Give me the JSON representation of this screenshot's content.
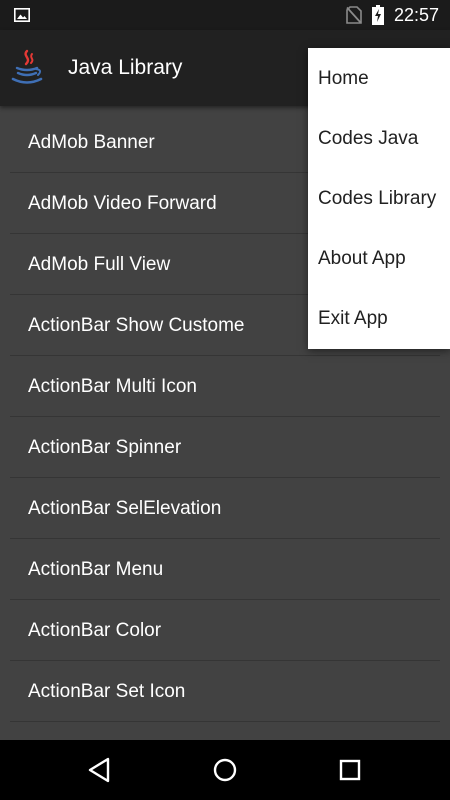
{
  "status_bar": {
    "time": "22:57",
    "icons": [
      "image-notification-icon",
      "no-sim-icon",
      "battery-charging-icon"
    ]
  },
  "action_bar": {
    "title": "Java Library",
    "icon": "java-logo-icon"
  },
  "list": {
    "items": [
      {
        "label": "AdMob Banner"
      },
      {
        "label": "AdMob Video Forward"
      },
      {
        "label": "AdMob Full View"
      },
      {
        "label": "ActionBar Show Custome"
      },
      {
        "label": "ActionBar Multi Icon"
      },
      {
        "label": "ActionBar Spinner"
      },
      {
        "label": "ActionBar SelElevation"
      },
      {
        "label": "ActionBar Menu"
      },
      {
        "label": "ActionBar Color"
      },
      {
        "label": "ActionBar Set Icon"
      },
      {
        "label": ""
      }
    ]
  },
  "menu": {
    "items": [
      {
        "label": "Home"
      },
      {
        "label": "Codes Java"
      },
      {
        "label": "Codes Library"
      },
      {
        "label": "About App"
      },
      {
        "label": "Exit App"
      }
    ]
  },
  "nav_bar": {
    "icons": [
      "back-icon",
      "home-icon",
      "recents-icon"
    ]
  },
  "colors": {
    "status_bar": "#1b1b1b",
    "action_bar": "#212121",
    "list_background": "#424242",
    "divider": "#353535",
    "menu_background": "#ffffff",
    "nav_bar": "#000000"
  }
}
